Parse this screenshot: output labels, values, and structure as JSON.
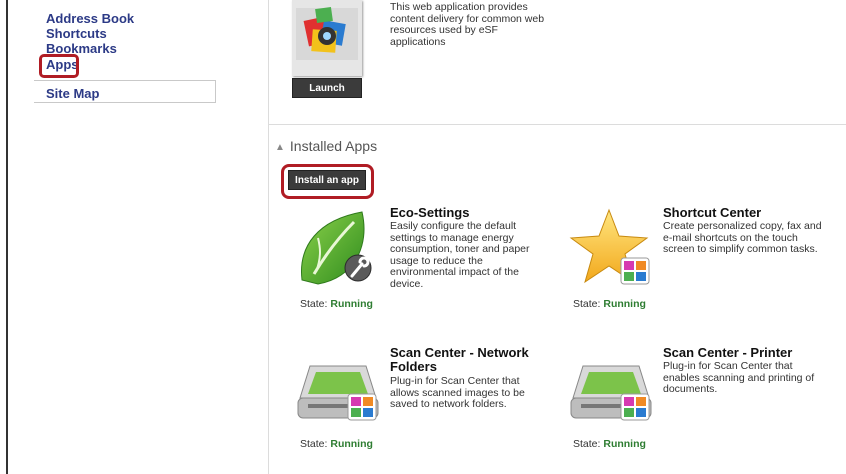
{
  "sidebar": {
    "items": [
      {
        "label": "Address Book"
      },
      {
        "label": "Shortcuts"
      },
      {
        "label": "Bookmarks"
      },
      {
        "label": "Apps"
      }
    ],
    "site_map": "Site Map"
  },
  "top_app": {
    "description": "This web application provides content delivery for common web resources used by eSF applications",
    "launch_label": "Launch"
  },
  "installed": {
    "header": "Installed Apps",
    "install_label": "Install an app",
    "state_label": "State:",
    "apps": [
      {
        "name": "Eco-Settings",
        "description": "Easily configure the default settings to manage energy consumption, toner and paper usage to reduce the environmental impact of the device.",
        "state": "Running",
        "icon": "eco-leaf-wrench-icon"
      },
      {
        "name": "Shortcut Center",
        "description": "Create personalized copy, fax and e-mail shortcuts on the touch screen to simplify common tasks.",
        "state": "Running",
        "icon": "star-icon"
      },
      {
        "name": "Scan Center - Network Folders",
        "description": "Plug-in for Scan Center that allows scanned images to be saved to network folders.",
        "state": "Running",
        "icon": "scanner-icon"
      },
      {
        "name": "Scan Center - Printer",
        "description": "Plug-in for Scan Center that enables scanning and printing of documents.",
        "state": "Running",
        "icon": "scanner-icon"
      }
    ]
  },
  "colors": {
    "link": "#2c3a86",
    "highlight": "#b01c24",
    "running": "#2e7d32",
    "button": "#3b3b3b"
  }
}
